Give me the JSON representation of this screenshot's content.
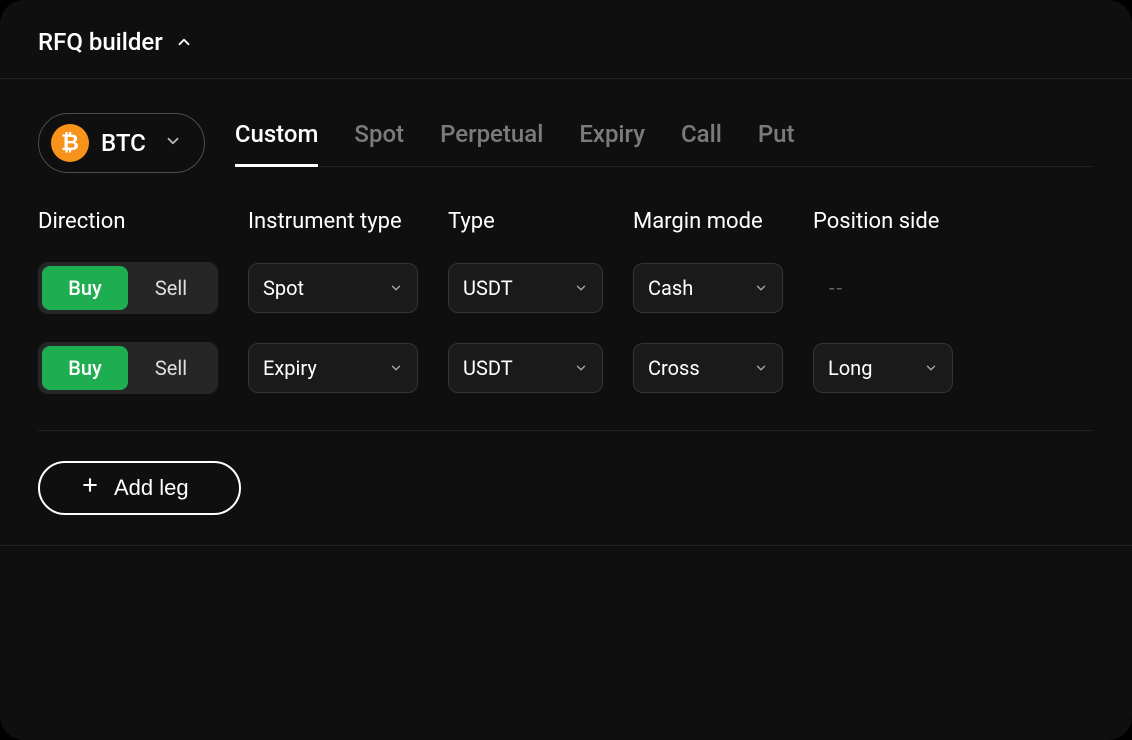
{
  "header": {
    "title": "RFQ builder"
  },
  "asset": {
    "symbol": "BTC",
    "iconGlyph": "₿"
  },
  "tabs": [
    {
      "label": "Custom",
      "active": true
    },
    {
      "label": "Spot",
      "active": false
    },
    {
      "label": "Perpetual",
      "active": false
    },
    {
      "label": "Expiry",
      "active": false
    },
    {
      "label": "Call",
      "active": false
    },
    {
      "label": "Put",
      "active": false
    }
  ],
  "columns": {
    "direction": "Direction",
    "instrument": "Instrument type",
    "type": "Type",
    "margin": "Margin mode",
    "position": "Position side"
  },
  "directionLabels": {
    "buy": "Buy",
    "sell": "Sell"
  },
  "legs": [
    {
      "direction": "buy",
      "instrument": "Spot",
      "type": "USDT",
      "margin": "Cash",
      "position": "--",
      "positionEmpty": true
    },
    {
      "direction": "buy",
      "instrument": "Expiry",
      "type": "USDT",
      "margin": "Cross",
      "position": "Long",
      "positionEmpty": false
    }
  ],
  "addLeg": {
    "label": "Add leg"
  }
}
